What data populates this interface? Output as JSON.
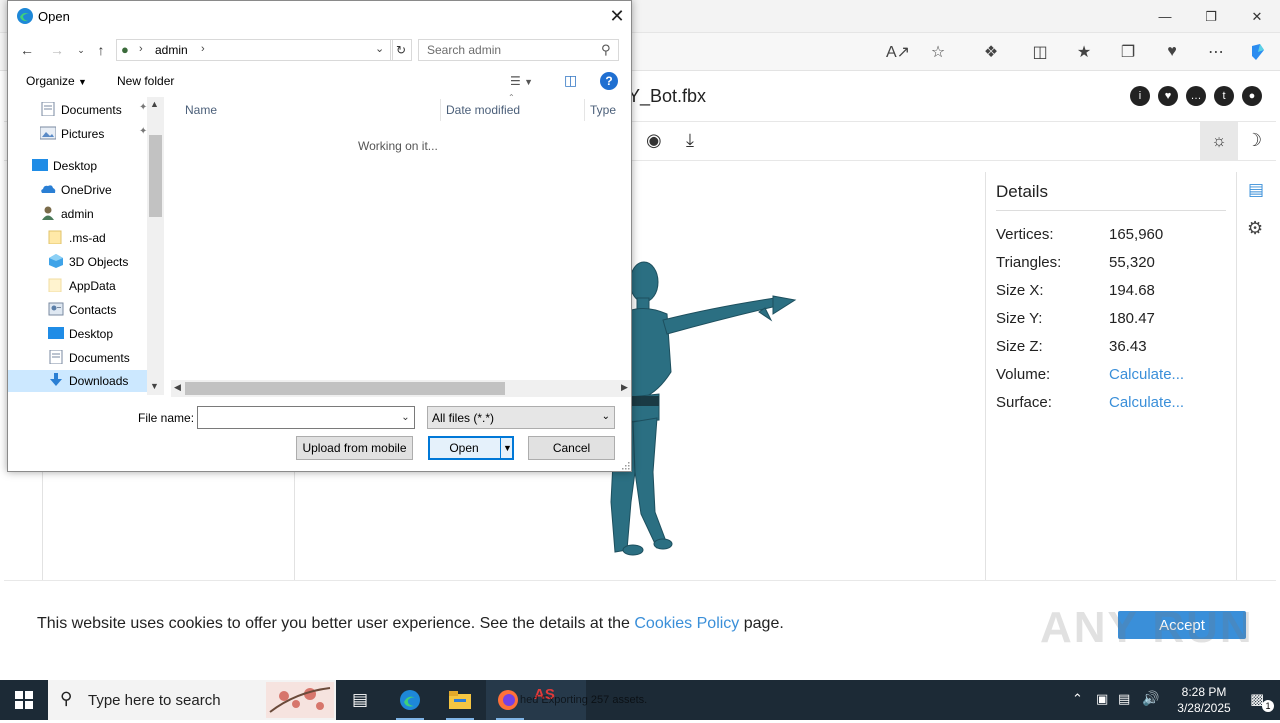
{
  "dialog": {
    "title": "Open",
    "path_crumb": "admin",
    "search_placeholder": "Search admin",
    "organize_label": "Organize",
    "new_folder_label": "New folder",
    "nav_items": [
      {
        "label": "Documents",
        "icon": "documents-icon",
        "pinned": true
      },
      {
        "label": "Pictures",
        "icon": "pictures-icon",
        "pinned": true
      },
      {
        "label": "Desktop",
        "icon": "desktop-icon"
      },
      {
        "label": "OneDrive",
        "icon": "onedrive-icon"
      },
      {
        "label": "admin",
        "icon": "user-folder-icon"
      },
      {
        "label": ".ms-ad",
        "icon": "folder-icon"
      },
      {
        "label": "3D Objects",
        "icon": "3d-objects-icon"
      },
      {
        "label": "AppData",
        "icon": "folder-icon"
      },
      {
        "label": "Contacts",
        "icon": "contacts-icon"
      },
      {
        "label": "Desktop",
        "icon": "desktop-icon"
      },
      {
        "label": "Documents",
        "icon": "documents-icon"
      },
      {
        "label": "Downloads",
        "icon": "downloads-icon",
        "selected": true
      }
    ],
    "columns": [
      "Name",
      "Date modified",
      "Type"
    ],
    "status_text": "Working on it...",
    "file_name_label": "File name:",
    "file_name_value": "",
    "file_type_value": "All files (*.*)",
    "upload_label": "Upload from mobile",
    "open_label": "Open",
    "cancel_label": "Cancel"
  },
  "page": {
    "model_title": "Y_Bot.fbx",
    "details": {
      "title": "Details",
      "rows": [
        {
          "label": "Vertices:",
          "value": "165,960"
        },
        {
          "label": "Triangles:",
          "value": "55,320"
        },
        {
          "label": "Size X:",
          "value": "194.68"
        },
        {
          "label": "Size Y:",
          "value": "180.47"
        },
        {
          "label": "Size Z:",
          "value": "36.43"
        },
        {
          "label": "Volume:",
          "value": "Calculate..."
        },
        {
          "label": "Surface:",
          "value": "Calculate..."
        }
      ]
    },
    "cookie": {
      "text_before": "This website uses cookies to offer you better user experience. See the details at the ",
      "link": "Cookies Policy",
      "text_after": " page.",
      "accept_label": "Accept"
    },
    "watermark": "ANY RUN"
  },
  "taskbar": {
    "search_placeholder": "Type here to search",
    "time": "8:28 PM",
    "date": "3/28/2025",
    "notification_count": "1",
    "ghost_text": "hed  Exporting 257 assets."
  },
  "colors": {
    "accent": "#0078d7",
    "link": "#3a8fd9",
    "model": "#2b6f82",
    "taskbar": "#1c2a36"
  }
}
